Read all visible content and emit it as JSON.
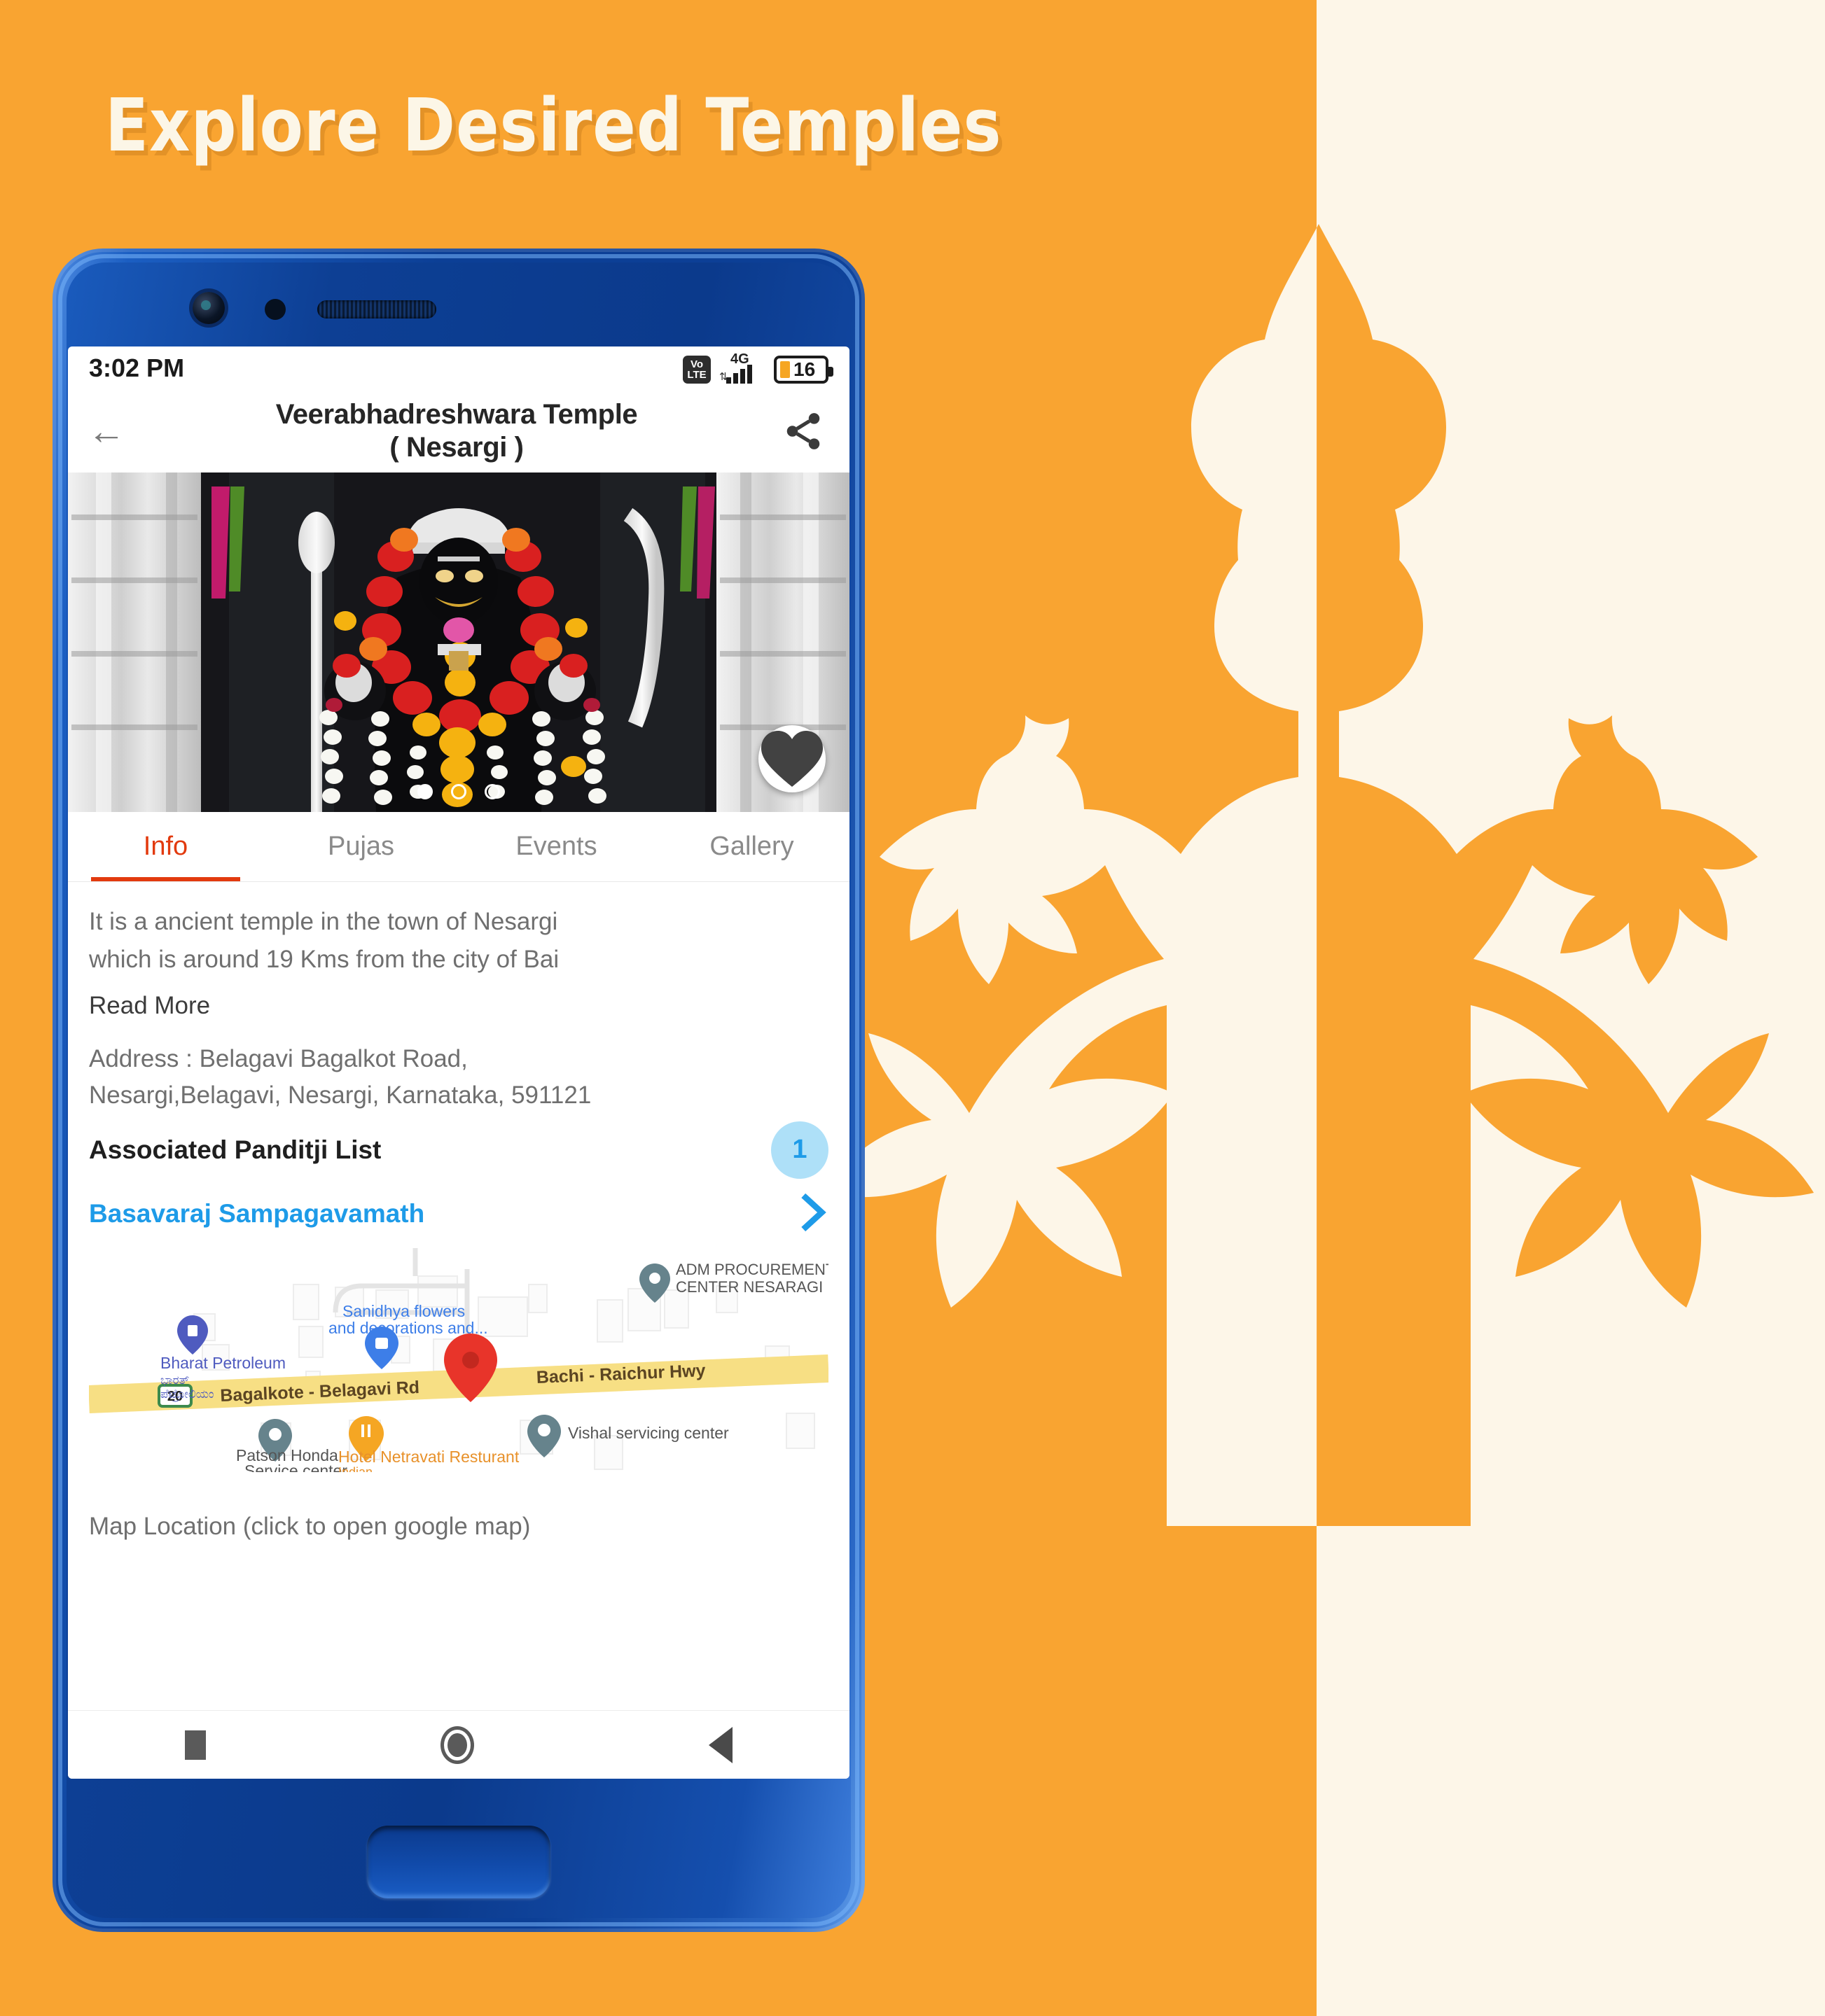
{
  "page": {
    "headline": "Explore Desired Temples",
    "background_color": "#F9A431",
    "background_alt_color": "#FDF6E8",
    "artwork_name": "deity-silhouette-with-lotus"
  },
  "phone": {
    "frame_color": "#0c3f96",
    "home_button_name": "hardware-home-button"
  },
  "statusbar": {
    "time": "3:02 PM",
    "volte_top": "Vo",
    "volte_bottom": "LTE",
    "network": "4G",
    "battery_level": "16"
  },
  "appbar": {
    "back_icon": "←",
    "title_line1": "Veerabhadreshwara Temple",
    "title_line2": "( Nesargi )",
    "share_icon": "share-icon"
  },
  "hero": {
    "alt": "Veerabhadreshwara temple deity with flower garlands",
    "dots": [
      true,
      false,
      false
    ],
    "favorite_icon": "heart-icon"
  },
  "tabs": [
    {
      "label": "Info",
      "active": true
    },
    {
      "label": "Pujas",
      "active": false
    },
    {
      "label": "Events",
      "active": false
    },
    {
      "label": "Gallery",
      "active": false
    }
  ],
  "tab_accent_color": "#E23A0E",
  "info": {
    "description_line1": "It is a ancient temple in the town of Nesargi",
    "description_line2": "which is around 19 Kms from the city of Bai",
    "read_more": "Read More",
    "address_line1": "Address : Belagavi Bagalkot Road,",
    "address_line2": "Nesargi,Belagavi, Nesargi, Karnataka, 591121",
    "panditji_title": "Associated Panditji List",
    "panditji_count": "1",
    "panditji_name": "Basavaraj Sampagavamath",
    "panditji_link_color": "#1E9BE8",
    "badge_bg_color": "#AEE0F8",
    "map_caption": "Map Location (click to open google map)"
  },
  "map": {
    "labels": {
      "adm_line1": "ADM PROCUREMENT",
      "adm_line2": "CENTER NESARAGI",
      "sanidhya_line1": "Sanidhya flowers",
      "sanidhya_line2": "and decorations and...",
      "bharat_petroleum": "Bharat Petroleum",
      "bharat_kannada1": "ಭಾರತ್",
      "bharat_kannada2": "ಪೆಟ್ರೋಲಿಯಂ",
      "road_main": "Bagalkote - Belagavi Rd",
      "road_secondary": "Bachi - Raichur Hwy",
      "highway_shield": "20",
      "patson_line1": "Patson Honda.",
      "patson_line2": "Service center",
      "hotel_line1": "Hotel Netravati Resturant",
      "hotel_line2": "Indian",
      "vishal": "Vishal servicing center"
    },
    "marker_color": "#E8342A",
    "road_color": "#FBE38A"
  },
  "navbar": {
    "recents": "recents-square-icon",
    "home": "home-circle-icon",
    "back": "back-triangle-icon"
  }
}
